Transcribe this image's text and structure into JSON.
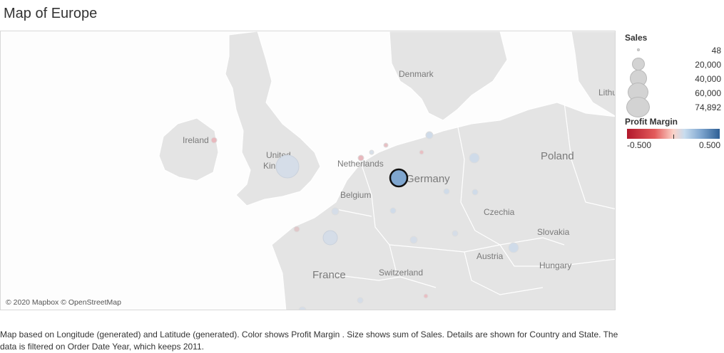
{
  "title": "Map of Europe",
  "attribution": "© 2020 Mapbox © OpenStreetMap",
  "country_labels": {
    "denmark": "Denmark",
    "ireland": "Ireland",
    "uk": "United Kingdom",
    "netherlands": "Netherlands",
    "germany": "Germany",
    "belgium": "Belgium",
    "poland": "Poland",
    "czechia": "Czechia",
    "slovakia": "Slovakia",
    "austria": "Austria",
    "hungary": "Hungary",
    "france": "France",
    "switzerland": "Switzerland",
    "lithuania": "Lithuania"
  },
  "legend": {
    "sales_title": "Sales",
    "sales_values": [
      "48",
      "20,000",
      "40,000",
      "60,000",
      "74,892"
    ],
    "profit_title": "Profit Margin",
    "profit_min": "-0.500",
    "profit_max": "0.500"
  },
  "caption": "Map based on Longitude (generated) and Latitude (generated).  Color shows Profit Margin .  Size shows sum of Sales.  Details are shown for Country and State. The data is filtered on Order Date Year, which keeps 2011.",
  "colors": {
    "land": "#e4e4e4",
    "water": "#fdfdfd",
    "border": "#ffffff",
    "highlight_fill": "#7fa6cf",
    "highlight_stroke": "#111111"
  }
}
